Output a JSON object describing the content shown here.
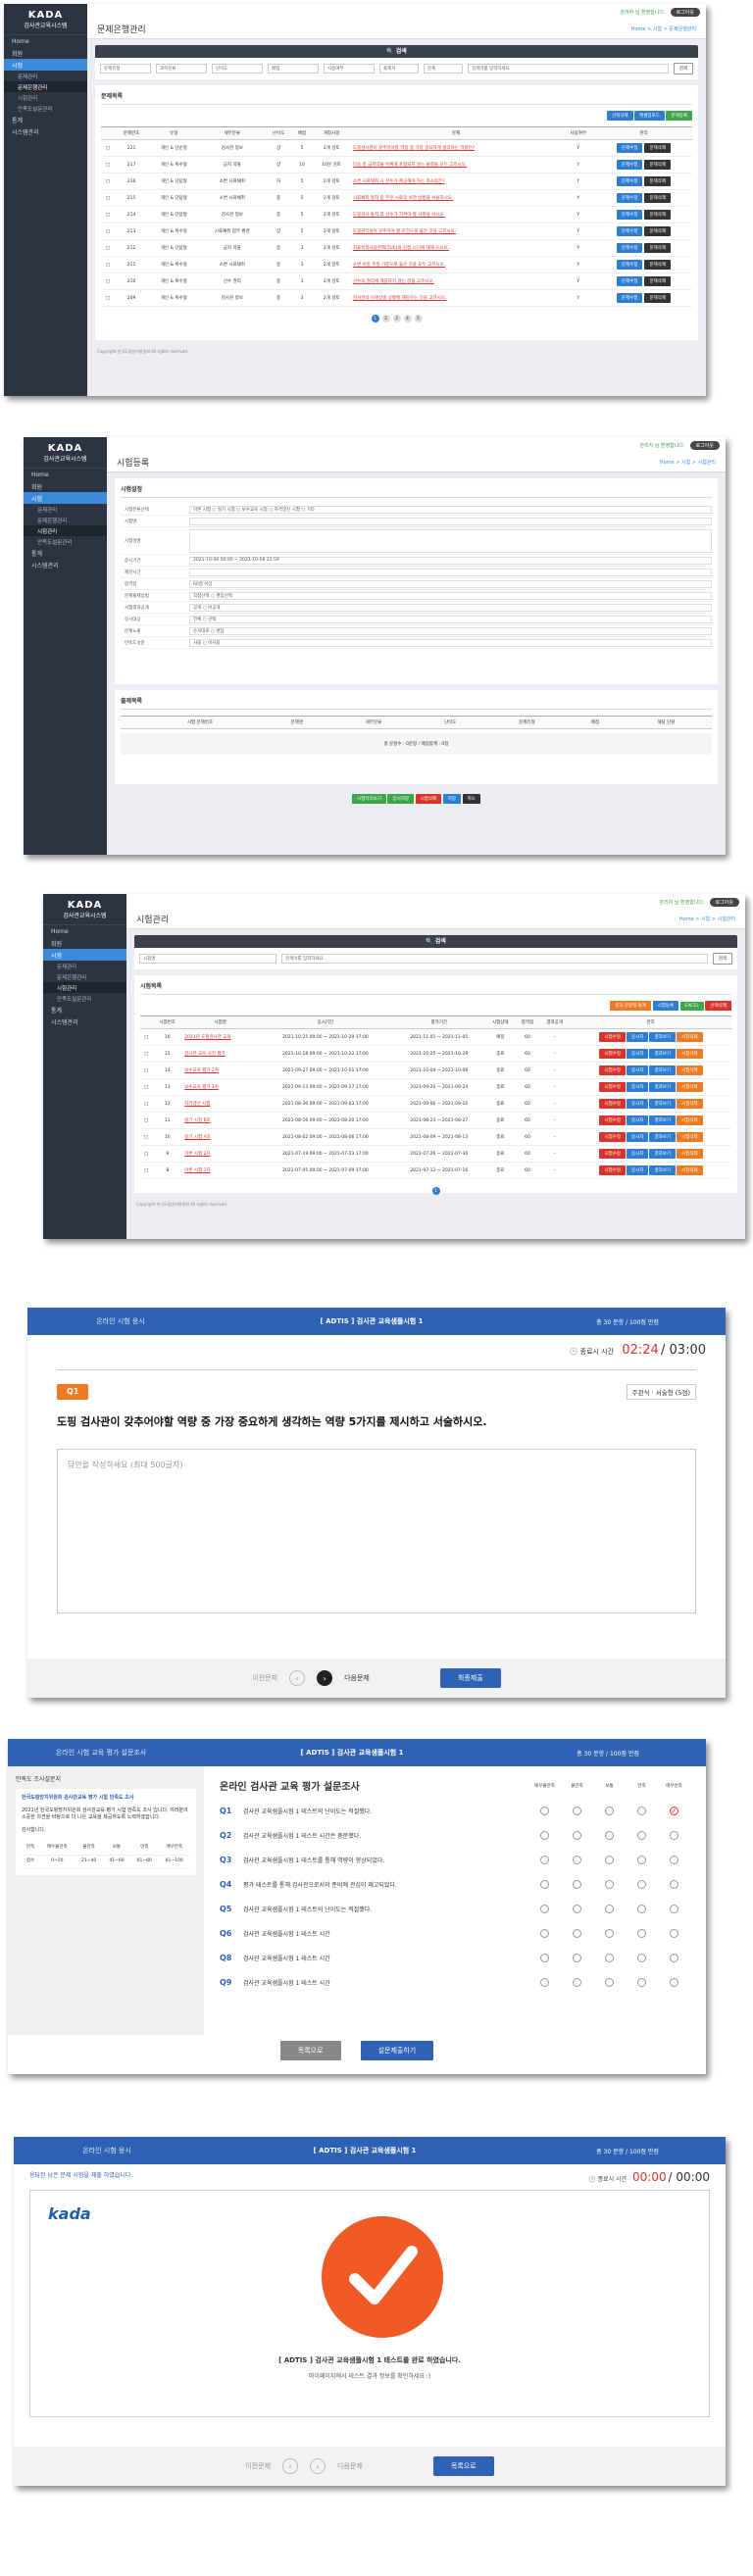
{
  "brand": {
    "name": "KADA",
    "subtitle": "검사관교육시스템"
  },
  "topbar": {
    "user": "관리자 님 환영합니다.",
    "logout": "로그아웃"
  },
  "sidebar": {
    "items": [
      {
        "label": "Home"
      },
      {
        "label": "회원"
      },
      {
        "label": "시험"
      },
      {
        "label": "통계"
      },
      {
        "label": "시스템관리"
      }
    ],
    "sub_items": [
      {
        "label": "문제관리"
      },
      {
        "label": "문제은행관리"
      },
      {
        "label": "시험관리"
      },
      {
        "label": "만족도설문관리"
      }
    ]
  },
  "screen1": {
    "title": "문제은행관리",
    "crumb": "Home > 시험 > 문제은행관리",
    "search_title": "검색",
    "filters": [
      "문제유형",
      "과목분류",
      "난이도",
      "배점",
      "사용여부",
      "출제자",
      "문제"
    ],
    "search_placeholder": "검색어를 입력하세요",
    "search_button": "검색",
    "list_title": "문제목록",
    "buttons": {
      "select": "선택삭제",
      "upload": "엑셀업로드",
      "register": "문제등록"
    },
    "columns": [
      "",
      "문제번호",
      "유형",
      "세부분류",
      "난이도",
      "배점",
      "개정사항",
      "문제",
      "사용여부",
      "관리"
    ],
    "rows": [
      {
        "no": "221",
        "type": "개인 & 단순형",
        "cat": "검사관 정보",
        "level": "상",
        "score": "5",
        "date": "2개 검토",
        "q": "도핑검사관이 갖추어야할 역량 중 가장 중요하게 생각하는 역량은?",
        "use": "Y"
      },
      {
        "no": "217",
        "type": "개인 & 복수형",
        "cat": "금지 약물",
        "level": "상",
        "score": "10",
        "date": "10문 검토",
        "q": "다음 중 금지약물 목록에 포함되지 않는 물질을 모두 고르시오.",
        "use": "Y"
      },
      {
        "no": "216",
        "type": "개인 & 단답형",
        "cat": "소변 시료채취",
        "level": "하",
        "score": "5",
        "date": "2개 검토",
        "q": "소변 시료채취 시 선수가 제공해야 하는 최소량은?",
        "use": "Y"
      },
      {
        "no": "215",
        "type": "개인 & 단답형",
        "cat": "소변 시료채취",
        "level": "중",
        "score": "5",
        "date": "2개 검토",
        "q": "시료채취 절차 중 부분 시료의 보관 방법을 서술하시오.",
        "use": "Y"
      },
      {
        "no": "214",
        "type": "개인 & 단답형",
        "cat": "검사관 정보",
        "level": "중",
        "score": "5",
        "date": "2개 검토",
        "q": "도핑검사 통지 후 선수가 지켜야 할 사항을 쓰시오.",
        "use": "Y"
      },
      {
        "no": "213",
        "type": "개인 & 복수형",
        "cat": "시료채취 업무 환경",
        "level": "상",
        "score": "5",
        "date": "2개 검토",
        "q": "도핑관리실이 갖추어야 할 조건으로 옳은 것을 고르시오.",
        "use": "Y"
      },
      {
        "no": "212",
        "type": "개인 & 단답형",
        "cat": "금지 약물",
        "level": "중",
        "score": "3",
        "date": "2개 검토",
        "q": "치료목적사용면책(TUE)의 신청 시기에 대해 쓰시오.",
        "use": "Y"
      },
      {
        "no": "211",
        "type": "개인 & 복수형",
        "cat": "소변 시료채취",
        "level": "중",
        "score": "3",
        "date": "2개 검토",
        "q": "소변 비중 측정 기준으로 옳은 것을 모두 고르시오.",
        "use": "Y"
      },
      {
        "no": "210",
        "type": "개인 & 복수형",
        "cat": "선수 권리",
        "level": "중",
        "score": "3",
        "date": "2개 검토",
        "q": "선수의 권리에 해당하지 않는 것을 고르시오.",
        "use": "Y"
      },
      {
        "no": "209",
        "type": "개인 & 복수형",
        "cat": "검사관 정보",
        "level": "중",
        "score": "3",
        "date": "2개 검토",
        "q": "검사관의 이해상충 상황에 해당하는 것을 고르시오.",
        "use": "Y"
      }
    ],
    "row_buttons": {
      "edit": "문제수정",
      "delete": "문제삭제"
    },
    "pages": [
      "1",
      "2",
      "3",
      "4",
      "5"
    ],
    "copyright": "Copyright 한국도핑방지위원회 All rights reserved."
  },
  "screen2": {
    "title": "시험등록",
    "crumb": "Home > 시험 > 시험관리",
    "section": "시험설정",
    "fields": [
      {
        "label": "시험분류선택",
        "value": "이론 시험  ○ 실기 시험  ○ 보수교육 시험  ○ 자격갱신 시험  ○ 기타"
      },
      {
        "label": "시험명",
        "value": ""
      },
      {
        "label": "시험설명",
        "value": ""
      },
      {
        "label": "응시기간",
        "value": "2021-10-08 00:00 ~ 2021-10-08 23:59"
      },
      {
        "label": "제한시간",
        "value": ""
      },
      {
        "label": "합격점",
        "value": "60점 이상"
      },
      {
        "label": "문제출제방법",
        "value": "직접선택  ○ 랜덤선택"
      },
      {
        "label": "시험결과공개",
        "value": "공개  ○ 비공개"
      },
      {
        "label": "응시대상",
        "value": "전체  ○ 선택"
      },
      {
        "label": "문제노출",
        "value": "순서대로  ○ 랜덤"
      },
      {
        "label": "만족도설문",
        "value": "사용  ○ 미사용"
      }
    ],
    "q_section": "출제목록",
    "q_columns": [
      "",
      "시험 문제번호",
      "문제명",
      "세부분류",
      "난이도",
      "문제유형",
      "배점",
      "해당 단원"
    ],
    "summary": "총 문항수 : 0문항 / 배점합계 : 0점",
    "buttons": {
      "preview": "시험미리보기",
      "save_temp": "임시저장",
      "delete": "시험삭제",
      "save": "저장",
      "cancel": "취소"
    }
  },
  "screen3": {
    "title": "시험관리",
    "crumb": "Home > 시험 > 시험관리",
    "search_title": "검색",
    "filter": "시험명",
    "search_placeholder": "검색어를 입력하세요",
    "search_button": "검색",
    "list_title": "시험목록",
    "buttons": {
      "survey": "결과 문항별 통계",
      "reg": "시험등록",
      "excel": "EXCEL",
      "del": "선택삭제"
    },
    "columns": [
      "",
      "시험번호",
      "시험명",
      "응시기간",
      "평가기간",
      "시험상태",
      "합격점",
      "결과공개",
      "관리"
    ],
    "rows": [
      {
        "no": "16",
        "name": "2021년 도핑검사관 교육",
        "period": "2021-10-25 09:00 ~ 2021-10-29 17:00",
        "eval": "2021-11-01 ~ 2021-11-05",
        "state": "예정",
        "pass": "60"
      },
      {
        "no": "15",
        "name": "검사관 교육 사전 평가",
        "period": "2021-10-18 09:00 ~ 2021-10-22 17:00",
        "eval": "2021-10-25 ~ 2021-10-29",
        "state": "종료",
        "pass": "60"
      },
      {
        "no": "14",
        "name": "보수교육 평가 2차",
        "period": "2021-09-27 09:00 ~ 2021-10-01 17:00",
        "eval": "2021-10-04 ~ 2021-10-08",
        "state": "종료",
        "pass": "60"
      },
      {
        "no": "13",
        "name": "보수교육 평가 1차",
        "period": "2021-09-13 09:00 ~ 2021-09-17 17:00",
        "eval": "2021-09-20 ~ 2021-09-24",
        "state": "종료",
        "pass": "60"
      },
      {
        "no": "12",
        "name": "자격갱신 시험",
        "period": "2021-08-30 09:00 ~ 2021-09-03 17:00",
        "eval": "2021-09-06 ~ 2021-09-10",
        "state": "종료",
        "pass": "60"
      },
      {
        "no": "11",
        "name": "실기 시험 B조",
        "period": "2021-08-16 09:00 ~ 2021-08-20 17:00",
        "eval": "2021-08-23 ~ 2021-08-27",
        "state": "종료",
        "pass": "60"
      },
      {
        "no": "10",
        "name": "실기 시험 A조",
        "period": "2021-08-02 09:00 ~ 2021-08-06 17:00",
        "eval": "2021-08-09 ~ 2021-08-13",
        "state": "종료",
        "pass": "60"
      },
      {
        "no": "9",
        "name": "이론 시험 2차",
        "period": "2021-07-19 09:00 ~ 2021-07-23 17:00",
        "eval": "2021-07-26 ~ 2021-07-30",
        "state": "종료",
        "pass": "60"
      },
      {
        "no": "8",
        "name": "이론 시험 1차",
        "period": "2021-07-05 09:00 ~ 2021-07-09 17:00",
        "eval": "2021-07-12 ~ 2021-07-16",
        "state": "종료",
        "pass": "60"
      }
    ],
    "row_buttons": {
      "a": "시험수정",
      "b": "응시자",
      "c": "결과보기",
      "d": "시험삭제"
    },
    "pages": [
      "1"
    ],
    "copyright": "Copyright 한국도핑방지위원회 All rights reserved."
  },
  "exam": {
    "left": "온라인 시험 응시",
    "title": "[ ADTIS ] 검사관 교육샘플시험 1",
    "info": "총 30 문항  /  100점 만점",
    "timer_label": "종료시 시간",
    "time_left": "02:24",
    "time_total": "03:00",
    "qno": "Q1",
    "qtype": "주관식 · 서술형 (5점)",
    "question": "도핑 검사관이 갖추어야할 역량 중 가장 중요하게 생각하는 역량 5가지를 제시하고 서술하시오.",
    "placeholder": "답안을 작성하세요 (최대 500글자)",
    "prev": "이전문제",
    "next": "다음문제",
    "submit": "최종제출"
  },
  "survey": {
    "left": "온라인 시험 교육 평가 설문조사",
    "title": "[ ADTIS ] 검사관 교육샘플시험 1",
    "info": "총 30 문항  /  100점 만점",
    "intro_title": "만족도 조사설문지",
    "intro_head": "한국도핑방지위원회 검사관교육 평가 시험 만족도 조사",
    "intro_text": "2021년 한국도핑방지위원회 검사관교육 평가 시험 만족도 조사 입니다. 여러분의 소중한 의견을 바탕으로 더 나은 교육을 제공하도록 노력하겠습니다.",
    "intro_thanks": "감사합니다.",
    "score_head": [
      "만족",
      "매우불만족",
      "불만족",
      "보통",
      "만족",
      "매우만족"
    ],
    "score_vals": [
      "점수",
      "0~20",
      "21~40",
      "41~60",
      "61~80",
      "81~100"
    ],
    "main_title": "온라인 검사관 교육 평가 설문조사",
    "cols": [
      "매우불만족",
      "불만족",
      "보통",
      "만족",
      "매우만족"
    ],
    "questions": [
      {
        "no": "Q1",
        "text": "검사관 교육샘플시험 1 테스트의 난이도는 적절했다."
      },
      {
        "no": "Q2",
        "text": "검사관 교육샘플시험 1 테스트 시간은 충분했다."
      },
      {
        "no": "Q3",
        "text": "검사관 교육샘플시험 1 테스트를 통해 역량이 향상되었다."
      },
      {
        "no": "Q4",
        "text": "평가 테스트를 통해 검사관으로서의 준비에 관심이 제고되었다."
      },
      {
        "no": "Q5",
        "text": "검사관 교육샘플시험 1 테스트의 난이도는 적절했다."
      },
      {
        "no": "Q6",
        "text": "검사관 교육샘플시험 1 테스트 시간"
      },
      {
        "no": "Q8",
        "text": "검사관 교육샘플시험 1 테스트 시간"
      },
      {
        "no": "Q9",
        "text": "검사관 교육샘플시험 1 테스트 시간"
      }
    ],
    "back": "목록으로",
    "submit": "설문제출하기"
  },
  "done": {
    "left": "온라인 시험 응시",
    "title": "[ ADTIS ] 검사관 교육샘플시험 1",
    "info": "총 30 문항  /  100점 만점",
    "note": "응답된 남은 문제 시험을 제출 하였습니다.",
    "timer_label": "종료시 시간",
    "time_left": "00:00",
    "time_total": "00:00",
    "logo": "kada",
    "msg": "[ ADTIS ] 검사관 교육샘플시험 1 테스트를 완료 하였습니다.",
    "sub": "마이페이지에서 테스트 결과 정보를 확인하세요 :)",
    "prev": "이전문제",
    "next": "다음문제",
    "back": "목록으로"
  },
  "colors": {
    "sidebar": "#2c3441",
    "accent": "#3b8ad9",
    "exam_header": "#2f62b4",
    "question_badge": "#ee7a23"
  }
}
